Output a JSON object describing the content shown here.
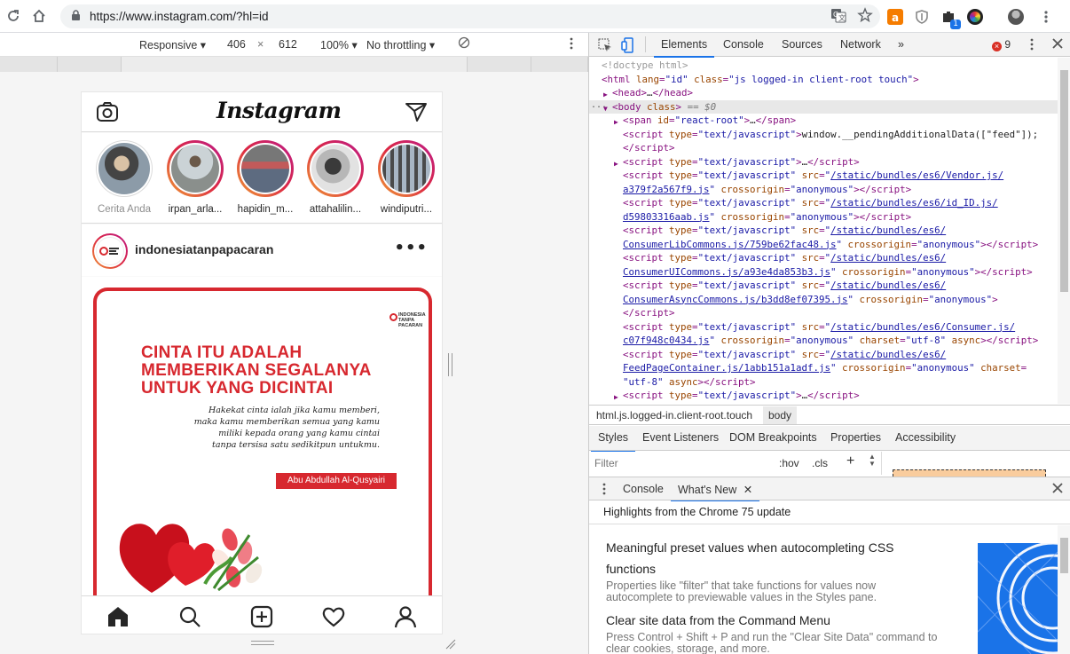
{
  "browser": {
    "url": "https://www.instagram.com/?hl=id",
    "extensions": [
      "translate-icon",
      "star-icon",
      "shopping-bag-icon",
      "shield-icon",
      "extension-icon",
      "color-wheel-icon"
    ],
    "extension_badge": "1"
  },
  "device_toolbar": {
    "device": "Responsive",
    "width": "406",
    "times": "×",
    "height": "612",
    "zoom": "100%",
    "throttle": "No throttling"
  },
  "instagram": {
    "logo": "Instagram",
    "stories": [
      {
        "name": "Cerita Anda",
        "own": true
      },
      {
        "name": "irpan_arla..."
      },
      {
        "name": "hapidin_m..."
      },
      {
        "name": "attahalilin..."
      },
      {
        "name": "windiputri..."
      }
    ],
    "post": {
      "username": "indonesiatanpapacaran",
      "more": "•••",
      "brand_lines": [
        "INDONESIA",
        "TANPA",
        "PACARAN"
      ],
      "quote_title": [
        "CINTA ITU ADALAH",
        "MEMBERIKAN SEGALANYA",
        "UNTUK YANG DICINTAI"
      ],
      "quote_body": [
        "Hakekat cinta ialah jika kamu memberi,",
        "maka kamu memberikan semua yang kamu",
        "miliki kepada orang yang kamu cintai",
        "tanpa tersisa satu sedikitpun untukmu."
      ],
      "quote_author": "Abu Abdullah Al-Qusyairi"
    }
  },
  "devtools": {
    "tabs": [
      "Elements",
      "Console",
      "Sources",
      "Network",
      "»"
    ],
    "active_tab": "Elements",
    "error_count": "9",
    "breadcrumbs": [
      "html.js.logged-in.client-root.touch",
      "body"
    ],
    "styles_tabs": [
      "Styles",
      "Event Listeners",
      "DOM Breakpoints",
      "Properties",
      "Accessibility"
    ],
    "filter_placeholder": "Filter",
    "hov": ":hov",
    "cls": ".cls",
    "drawer_tabs": [
      "Console",
      "What's New"
    ],
    "whats_new_header": "Highlights from the Chrome 75 update",
    "whats_new": [
      {
        "title": "Meaningful preset values when autocompleting CSS",
        "title2": "functions",
        "desc": "Properties like \"filter\" that take functions for values now autocomplete to previewable values in the Styles pane."
      },
      {
        "title": "Clear site data from the Command Menu",
        "desc": "Press Control + Shift + P and run the \"Clear Site Data\" command to clear cookies, storage, and more."
      }
    ],
    "dom_lines": [
      {
        "indent": 0,
        "html": "<span class='cm'>&lt;!doctype html&gt;</span>"
      },
      {
        "indent": 0,
        "html": "<span class='tg'>&lt;html</span> <span class='an'>lang</span>=<span class='av'>\"id\"</span> <span class='an'>class</span>=<span class='av'>\"js logged-in client-root touch\"</span><span class='tg'>&gt;</span>"
      },
      {
        "indent": 1,
        "tri": "▶",
        "html": "<span class='tg'>&lt;head&gt;</span><span class='tx'>…</span><span class='tg'>&lt;/head&gt;</span>"
      },
      {
        "indent": 1,
        "tri": "▼",
        "sel": true,
        "html": "<span class='tg'>&lt;body</span> <span class='an'>class</span><span class='tg'>&gt;</span> <span class='eq'>== $0</span>"
      },
      {
        "indent": 2,
        "tri": "▶",
        "html": "<span class='tg'>&lt;span</span> <span class='an'>id</span>=<span class='av'>\"react-root\"</span><span class='tg'>&gt;</span><span class='tx'>…</span><span class='tg'>&lt;/span&gt;</span>"
      },
      {
        "indent": 2,
        "html": "<span class='tg'>&lt;script</span> <span class='an'>type</span>=<span class='av'>\"text/javascript\"</span><span class='tg'>&gt;</span><span class='tx'>window.__pendingAdditionalData([\"feed\"]);</span>"
      },
      {
        "indent": 2,
        "html": "<span class='tg'>&lt;/script&gt;</span>"
      },
      {
        "indent": 2,
        "tri": "▶",
        "html": "<span class='tg'>&lt;script</span> <span class='an'>type</span>=<span class='av'>\"text/javascript\"</span><span class='tg'>&gt;</span><span class='tx'>…</span><span class='tg'>&lt;/script&gt;</span>"
      },
      {
        "indent": 2,
        "html": "<span class='tg'>&lt;script</span> <span class='an'>type</span>=<span class='av'>\"text/javascript\"</span> <span class='an'>src</span>=<span class='av'>\"<span class='lk'>/static/bundles/es6/Vendor.js/</span></span>"
      },
      {
        "indent": 2,
        "html": "<span class='av'><span class='lk'>a379f2a567f9.js</span>\"</span> <span class='an'>crossorigin</span>=<span class='av'>\"anonymous\"</span><span class='tg'>&gt;&lt;/script&gt;</span>"
      },
      {
        "indent": 2,
        "html": "<span class='tg'>&lt;script</span> <span class='an'>type</span>=<span class='av'>\"text/javascript\"</span> <span class='an'>src</span>=<span class='av'>\"<span class='lk'>/static/bundles/es6/id_ID.js/</span></span>"
      },
      {
        "indent": 2,
        "html": "<span class='av'><span class='lk'>d59803316aab.js</span>\"</span> <span class='an'>crossorigin</span>=<span class='av'>\"anonymous\"</span><span class='tg'>&gt;&lt;/script&gt;</span>"
      },
      {
        "indent": 2,
        "html": "<span class='tg'>&lt;script</span> <span class='an'>type</span>=<span class='av'>\"text/javascript\"</span> <span class='an'>src</span>=<span class='av'>\"<span class='lk'>/static/bundles/es6/</span></span>"
      },
      {
        "indent": 2,
        "html": "<span class='av'><span class='lk'>ConsumerLibCommons.js/759be62fac48.js</span>\"</span> <span class='an'>crossorigin</span>=<span class='av'>\"anonymous\"</span><span class='tg'>&gt;&lt;/script&gt;</span>"
      },
      {
        "indent": 2,
        "html": "<span class='tg'>&lt;script</span> <span class='an'>type</span>=<span class='av'>\"text/javascript\"</span> <span class='an'>src</span>=<span class='av'>\"<span class='lk'>/static/bundles/es6/</span></span>"
      },
      {
        "indent": 2,
        "html": "<span class='av'><span class='lk'>ConsumerUICommons.js/a93e4da853b3.js</span>\"</span> <span class='an'>crossorigin</span>=<span class='av'>\"anonymous\"</span><span class='tg'>&gt;&lt;/script&gt;</span>"
      },
      {
        "indent": 2,
        "html": "<span class='tg'>&lt;script</span> <span class='an'>type</span>=<span class='av'>\"text/javascript\"</span> <span class='an'>src</span>=<span class='av'>\"<span class='lk'>/static/bundles/es6/</span></span>"
      },
      {
        "indent": 2,
        "html": "<span class='av'><span class='lk'>ConsumerAsyncCommons.js/b3dd8ef07395.js</span>\"</span> <span class='an'>crossorigin</span>=<span class='av'>\"anonymous\"</span><span class='tg'>&gt;</span>"
      },
      {
        "indent": 2,
        "html": "<span class='tg'>&lt;/script&gt;</span>"
      },
      {
        "indent": 2,
        "html": "<span class='tg'>&lt;script</span> <span class='an'>type</span>=<span class='av'>\"text/javascript\"</span> <span class='an'>src</span>=<span class='av'>\"<span class='lk'>/static/bundles/es6/Consumer.js/</span></span>"
      },
      {
        "indent": 2,
        "html": "<span class='av'><span class='lk'>c07f948c0434.js</span>\"</span> <span class='an'>crossorigin</span>=<span class='av'>\"anonymous\"</span> <span class='an'>charset</span>=<span class='av'>\"utf-8\"</span> <span class='an'>async</span><span class='tg'>&gt;&lt;/script&gt;</span>"
      },
      {
        "indent": 2,
        "html": "<span class='tg'>&lt;script</span> <span class='an'>type</span>=<span class='av'>\"text/javascript\"</span> <span class='an'>src</span>=<span class='av'>\"<span class='lk'>/static/bundles/es6/</span></span>"
      },
      {
        "indent": 2,
        "html": "<span class='av'><span class='lk'>FeedPageContainer.js/1abb151a1adf.js</span>\"</span> <span class='an'>crossorigin</span>=<span class='av'>\"anonymous\"</span> <span class='an'>charset</span>="
      },
      {
        "indent": 2,
        "html": "<span class='av'>\"utf-8\"</span> <span class='an'>async</span><span class='tg'>&gt;&lt;/script&gt;</span>"
      },
      {
        "indent": 2,
        "tri": "▶",
        "html": "<span class='tg'>&lt;script</span> <span class='an'>type</span>=<span class='av'>\"text/javascript\"</span><span class='tg'>&gt;</span><span class='tx'>…</span><span class='tg'>&lt;/script&gt;</span>"
      }
    ]
  },
  "colors": {
    "instagram_red": "#d7282f",
    "devtools_accent": "#1a73e8",
    "error_red": "#d93025"
  }
}
